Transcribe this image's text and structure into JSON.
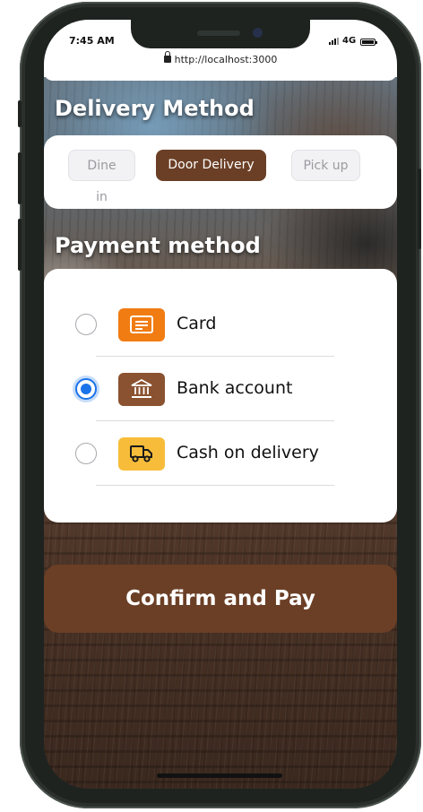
{
  "status_bar": {
    "time": "7:45 AM",
    "network": "4G",
    "url": "http://localhost:3000"
  },
  "delivery": {
    "heading": "Delivery Method",
    "options": [
      {
        "label": "Dine in",
        "selected": false
      },
      {
        "label": "Door Delivery",
        "selected": true
      },
      {
        "label": "Pick up",
        "selected": false
      }
    ]
  },
  "payment": {
    "heading": "Payment method",
    "options": [
      {
        "label": "Card",
        "icon": "card-icon",
        "icon_color": "#f07c12",
        "selected": false
      },
      {
        "label": "Bank account",
        "icon": "bank-icon",
        "icon_color": "#8a5230",
        "selected": true
      },
      {
        "label": "Cash on delivery",
        "icon": "truck-icon",
        "icon_color": "#f7bd3a",
        "selected": false
      }
    ]
  },
  "confirm": {
    "label": "Confirm and Pay"
  },
  "colors": {
    "accent_brown": "#6b3f26",
    "radio_blue": "#1a73e8"
  }
}
